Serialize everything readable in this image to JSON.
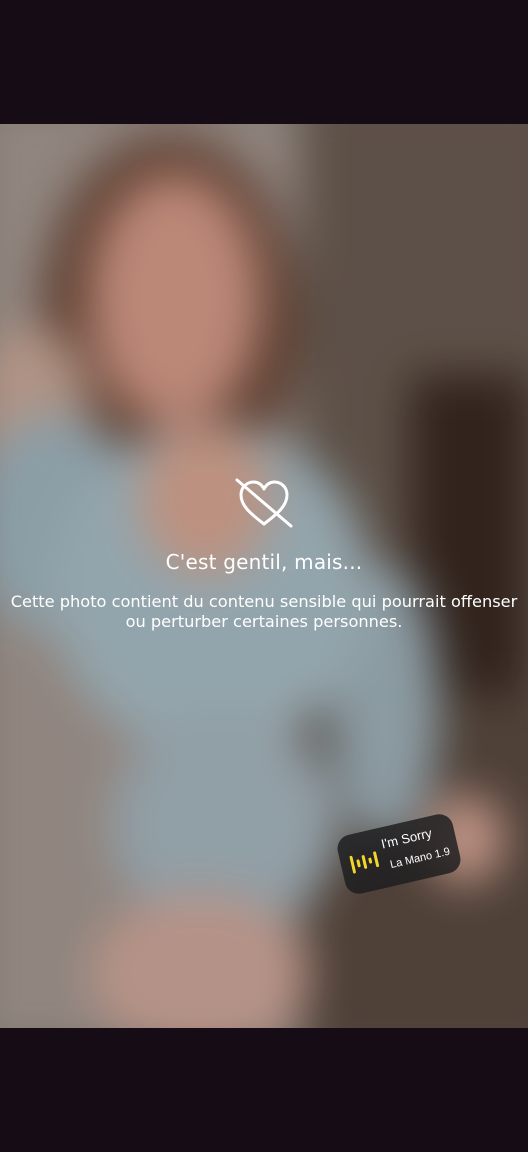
{
  "sensitive_content": {
    "icon": "crossed-out-heart-icon",
    "title": "C'est gentil, mais...",
    "description": "Cette photo contient du contenu sensible qui pourrait offenser ou perturber certaines personnes."
  },
  "music_sticker": {
    "icon": "music-equalizer-icon",
    "accent_color": "#f3d62a",
    "song": "I'm Sorry",
    "artist": "La Mano 1.9"
  },
  "colors": {
    "letterbox": "#150c15",
    "overlay_text": "#ffffff"
  }
}
